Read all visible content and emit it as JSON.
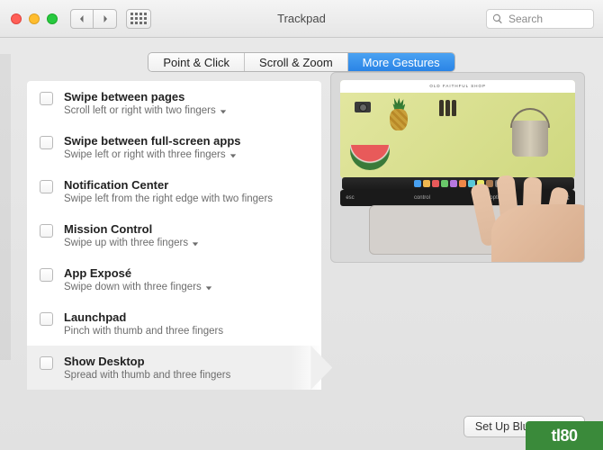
{
  "window": {
    "title": "Trackpad"
  },
  "search": {
    "placeholder": "Search"
  },
  "tabs": [
    {
      "label": "Point & Click",
      "active": false
    },
    {
      "label": "Scroll & Zoom",
      "active": false
    },
    {
      "label": "More Gestures",
      "active": true
    }
  ],
  "options": [
    {
      "title": "Swipe between pages",
      "sub": "Scroll left or right with two fingers",
      "dropdown": true,
      "selected": false
    },
    {
      "title": "Swipe between full-screen apps",
      "sub": "Swipe left or right with three fingers",
      "dropdown": true,
      "selected": false
    },
    {
      "title": "Notification Center",
      "sub": "Swipe left from the right edge with two fingers",
      "dropdown": false,
      "selected": false
    },
    {
      "title": "Mission Control",
      "sub": "Swipe up with three fingers",
      "dropdown": true,
      "selected": false
    },
    {
      "title": "App Exposé",
      "sub": "Swipe down with three fingers",
      "dropdown": true,
      "selected": false
    },
    {
      "title": "Launchpad",
      "sub": "Pinch with thumb and three fingers",
      "dropdown": false,
      "selected": false
    },
    {
      "title": "Show Desktop",
      "sub": "Spread with thumb and three fingers",
      "dropdown": false,
      "selected": true
    }
  ],
  "preview": {
    "site_header": "OLD FAITHFUL SHOP",
    "touchbar_left": "esc",
    "touchbar_mid1": "control",
    "touchbar_mid2": "option",
    "touchbar_right": "⌘"
  },
  "footer": {
    "bluetooth_button": "Set Up Bluetooth Tr"
  },
  "watermark": "tl80",
  "dock_colors": [
    "#48a0f0",
    "#f0b850",
    "#e85a5a",
    "#6ac86a",
    "#b878e0",
    "#f08848",
    "#58c8d8",
    "#e8e868",
    "#a87850",
    "#787878"
  ]
}
